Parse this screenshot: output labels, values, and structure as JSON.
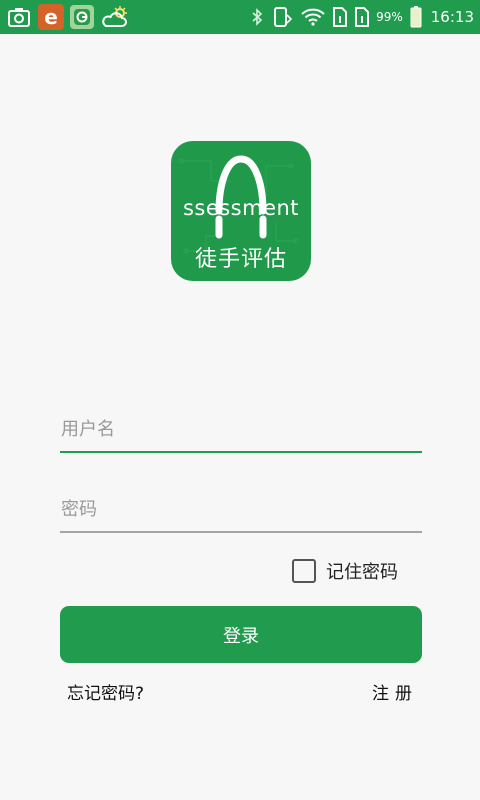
{
  "status_bar": {
    "left_icons": [
      "screenshot-icon",
      "e-app-icon",
      "green-app-icon",
      "weather-icon"
    ],
    "right_icons": [
      "bluetooth-icon",
      "phone-sim-icon",
      "wifi-icon",
      "sim1-icon",
      "sim2-icon",
      "battery-icon"
    ],
    "e_app_glyph": "e",
    "battery_percent": "99%",
    "time": "16:13",
    "bar_color": "#219c4f"
  },
  "logo": {
    "word": "ssessment",
    "name": "徒手评估",
    "bg_color": "#21994a"
  },
  "form": {
    "username_placeholder": "用户名",
    "password_placeholder": "密码",
    "remember_label": "记住密码",
    "remember_checked": false,
    "login_label": "登录",
    "forgot_label": "忘记密码?",
    "register_label": "注册"
  },
  "accent_color": "#219c4f"
}
